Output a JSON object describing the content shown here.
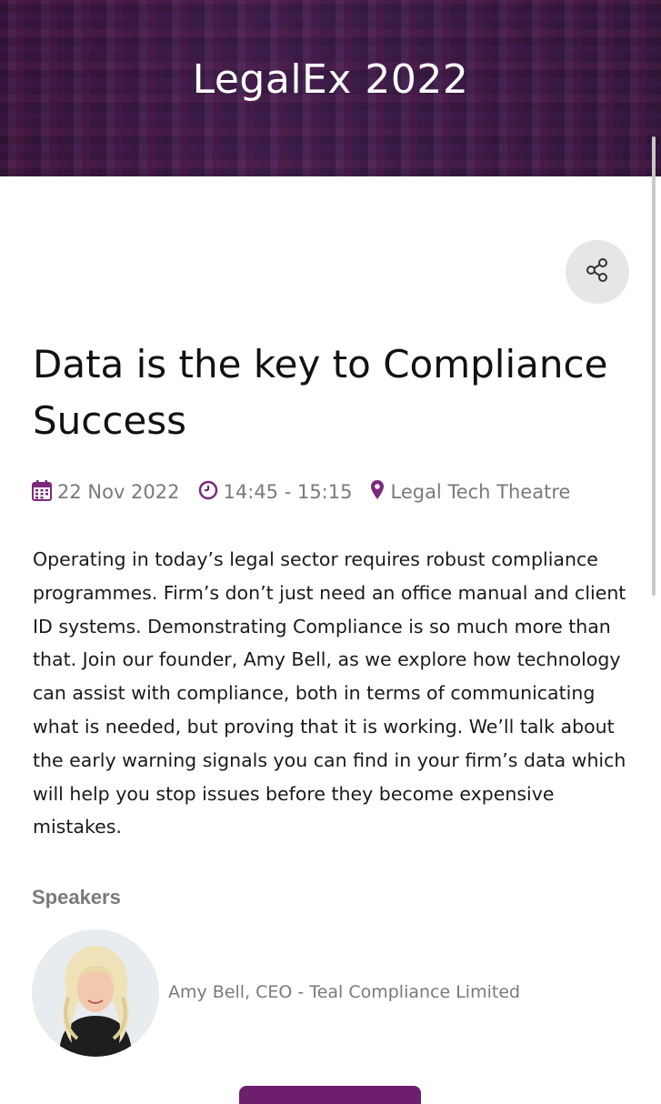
{
  "header": {
    "title": "LegalEx 2022"
  },
  "session": {
    "title": "Data is the key to Compliance Success",
    "date": "22 Nov 2022",
    "time": "14:45 - 15:15",
    "location": "Legal Tech Theatre",
    "description": "Operating in today’s legal sector requires robust compliance programmes. Firm’s don’t just need an office manual and client ID systems. Demonstrating Compliance is so much more than that. Join our founder, Amy Bell, as we explore how technology can assist with compliance, both in terms of communicating what is needed, but proving that it is working. We’ll talk about the early warning signals you can find in your firm’s data which will help you stop issues before they become expensive mistakes."
  },
  "speakers": {
    "heading": "Speakers",
    "items": [
      {
        "name": "Amy Bell, CEO - Teal Compliance Limited"
      }
    ]
  },
  "icons": {
    "share": "share-icon",
    "date": "calendar-icon",
    "time": "clock-icon",
    "location": "map-pin-icon"
  },
  "colors": {
    "accent": "#7a2a7c",
    "header_bg": "#3d1742",
    "muted_text": "#7a7a7a"
  }
}
